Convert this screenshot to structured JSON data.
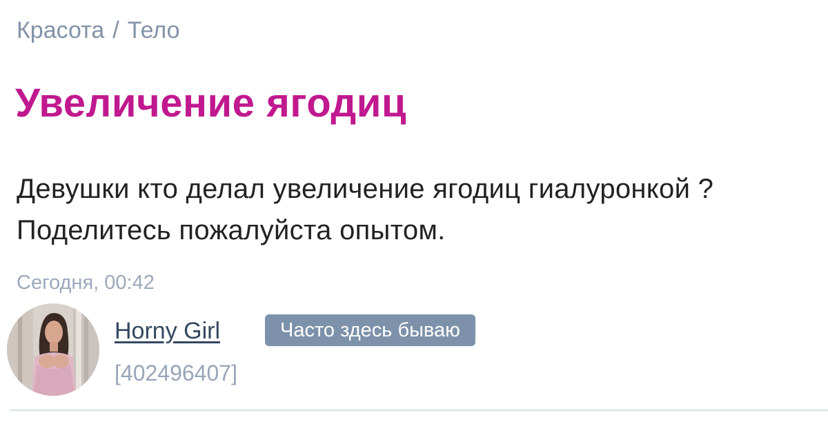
{
  "breadcrumb": {
    "items": [
      "Красота",
      "Тело"
    ],
    "separator": "/"
  },
  "post": {
    "title": "Увеличение ягодиц",
    "body": "Девушки кто делал увеличение ягодиц гиалуронкой ? Поделитесь пожалуйста опытом.",
    "date": "Сегодня, 00:42"
  },
  "author": {
    "name": "Horny Girl",
    "badge": "Часто здесь бываю",
    "id": "[402496407]"
  },
  "colors": {
    "title": "#c0198f",
    "breadcrumb": "#8293a8",
    "badge_bg": "#7d92aa",
    "meta": "#9aa9bb",
    "divider": "#d6e1ec"
  }
}
